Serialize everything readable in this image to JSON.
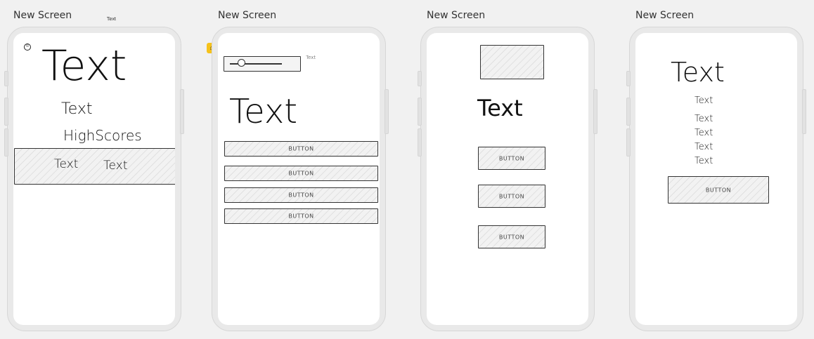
{
  "screens": [
    {
      "title": "New Screen",
      "floating_label": "Text",
      "big_text": "Text",
      "medium_text": "Text",
      "highscores": "HighScores",
      "table_cells": [
        "Text",
        "Text"
      ]
    },
    {
      "title": "New Screen",
      "slider_label": "Text",
      "big_text": "Text",
      "buttons": [
        "BUTTON",
        "BUTTON",
        "BUTTON",
        "BUTTON"
      ]
    },
    {
      "title": "New Screen",
      "big_text": "Text",
      "buttons": [
        "BUTTON",
        "BUTTON",
        "BUTTON"
      ]
    },
    {
      "title": "New Screen",
      "big_text": "Text",
      "list_items": [
        "Text",
        "Text",
        "Text",
        "Text",
        "Text"
      ],
      "button": "BUTTON"
    }
  ],
  "colors": {
    "canvas": "#f1f1f1",
    "phone_frame": "#e9e9e9",
    "home_badge": "#f6c21b"
  },
  "icons": [
    "home-icon",
    "copyright-icon"
  ]
}
